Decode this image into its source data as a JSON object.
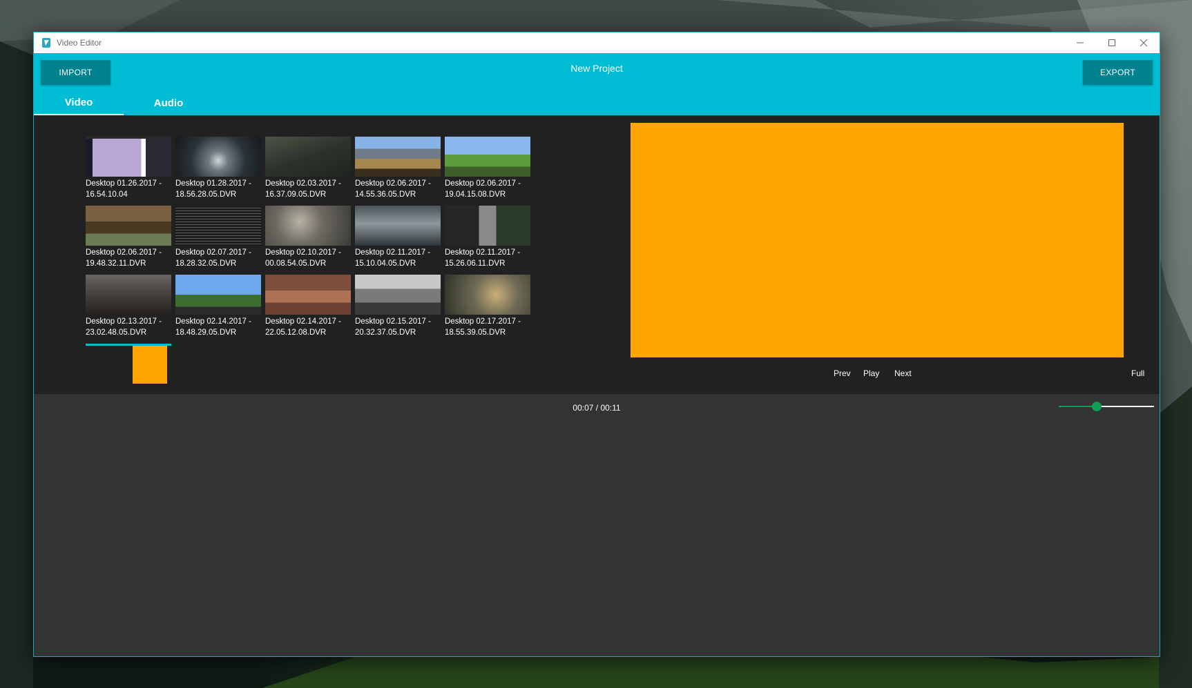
{
  "window": {
    "title": "Video Editor"
  },
  "header": {
    "import_label": "IMPORT",
    "export_label": "EXPORT",
    "project_title": "New Project",
    "tabs": [
      {
        "label": "Video",
        "active": true
      },
      {
        "label": "Audio",
        "active": false
      }
    ]
  },
  "library": {
    "items": [
      {
        "label": "Desktop 01.26.2017 -\n16.54.10.04",
        "thumb": "purple-desktop"
      },
      {
        "label": "Desktop 01.28.2017 -\n18.56.28.05.DVR",
        "thumb": "dark-scifi"
      },
      {
        "label": "Desktop 02.03.2017 -\n16.37.09.05.DVR",
        "thumb": "dark-green-fps"
      },
      {
        "label": "Desktop 02.06.2017 -\n14.55.36.05.DVR",
        "thumb": "minecraft-corridor"
      },
      {
        "label": "Desktop 02.06.2017 -\n19.04.15.08.DVR",
        "thumb": "minecraft-sky"
      },
      {
        "label": "Desktop 02.06.2017 -\n19.48.32.11.DVR",
        "thumb": "minecraft-wood"
      },
      {
        "label": "Desktop 02.07.2017 -\n18.28.32.05.DVR",
        "thumb": "code-editor"
      },
      {
        "label": "Desktop 02.10.2017 -\n00.08.54.05.DVR",
        "thumb": "battle-scene"
      },
      {
        "label": "Desktop 02.11.2017 -\n15.10.04.05.DVR",
        "thumb": "scifi-hangar"
      },
      {
        "label": "Desktop 02.11.2017 -\n15.26.06.11.DVR",
        "thumb": "inventory"
      },
      {
        "label": "Desktop 02.13.2017 -\n23.02.48.05.DVR",
        "thumb": "shooter-room"
      },
      {
        "label": "Desktop 02.14.2017 -\n18.48.29.05.DVR",
        "thumb": "minecraft-blue"
      },
      {
        "label": "Desktop 02.14.2017 -\n22.05.12.08.DVR",
        "thumb": "desert-street"
      },
      {
        "label": "Desktop 02.15.2017 -\n20.32.37.05.DVR",
        "thumb": "grayscale-war"
      },
      {
        "label": "Desktop 02.17.2017 -\n18.55.39.05.DVR",
        "thumb": "hero-select"
      },
      {
        "label": "",
        "thumb": "editor-screenshot"
      }
    ]
  },
  "player": {
    "preview_color": "#ffa500",
    "prev_label": "Prev",
    "play_label": "Play",
    "next_label": "Next",
    "full_label": "Full"
  },
  "timeline": {
    "time_display": "00:07 / 00:11",
    "zoom_fraction": 0.4
  },
  "colors": {
    "header": "#00bcd4",
    "button": "#00838f",
    "accent_green": "#0f9d58"
  }
}
